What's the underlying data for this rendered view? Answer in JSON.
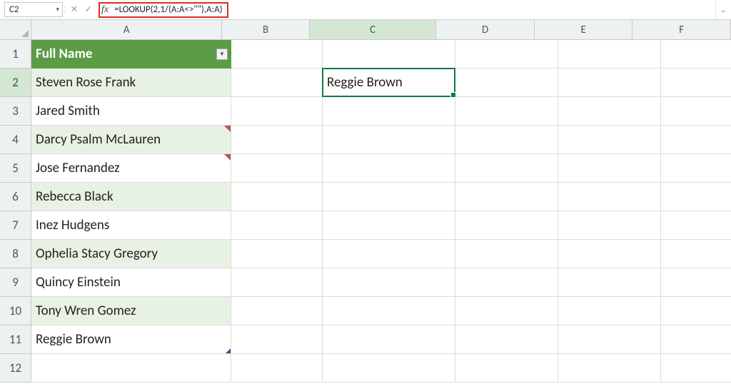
{
  "formula_bar": {
    "cell_ref": "C2",
    "cancel_label": "✕",
    "confirm_label": "✓",
    "fx_label": "fx",
    "formula": "=LOOKUP(2,1/(A:A<>\"\"),A:A)",
    "expand_label": "⌄"
  },
  "columns": [
    "A",
    "B",
    "C",
    "D",
    "E",
    "F"
  ],
  "rows": [
    "1",
    "2",
    "3",
    "4",
    "5",
    "6",
    "7",
    "8",
    "9",
    "10",
    "11",
    "12"
  ],
  "active_col": "C",
  "active_row": "2",
  "table": {
    "header": "Full Name",
    "names": [
      "Steven Rose Frank",
      "Jared  Smith",
      "Darcy Psalm McLauren",
      "Jose  Fernandez",
      "Rebecca  Black",
      "Inez  Hudgens",
      "Ophelia Stacy Gregory",
      "Quincy  Einstein",
      "Tony Wren Gomez",
      "Reggie  Brown"
    ]
  },
  "c2_value": "Reggie  Brown",
  "icons": {
    "dropdown": "▾",
    "filter": "▼"
  }
}
